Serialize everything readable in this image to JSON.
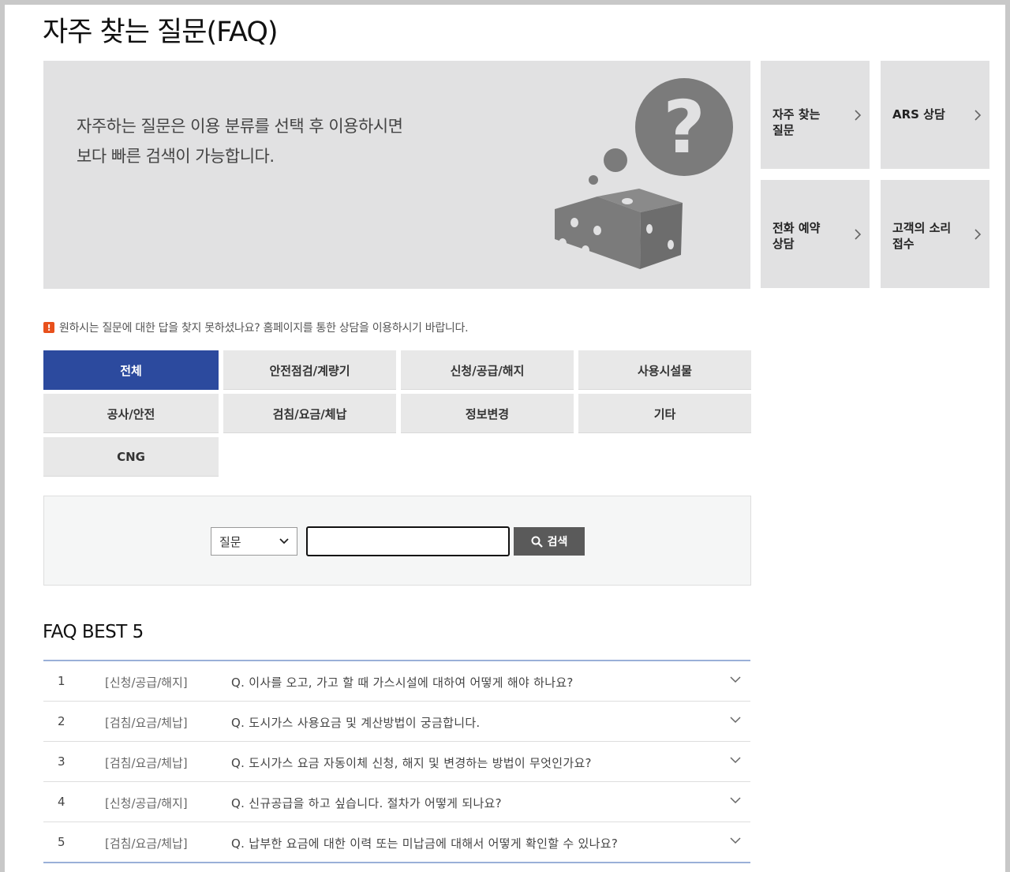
{
  "page": {
    "title": "자주 찾는 질문(FAQ)"
  },
  "hero": {
    "line1": "자주하는 질문은 이용 분류를 선택 후 이용하시면",
    "line2": "보다 빠른 검색이 가능합니다.",
    "illustration": "dice-question-icon"
  },
  "quick_links": [
    {
      "label": "자주 찾는\n질문",
      "icon": "chevron-right-icon"
    },
    {
      "label": "ARS 상담",
      "icon": "chevron-right-icon"
    },
    {
      "label": "전화 예약\n상담",
      "icon": "chevron-right-icon"
    },
    {
      "label": "고객의 소리\n접수",
      "icon": "chevron-right-icon"
    }
  ],
  "notice": {
    "icon": "alert-icon",
    "text": "원하시는 질문에 대한 답을 찾지 못하셨나요? 홈페이지를 통한 상담을 이용하시기 바랍니다."
  },
  "categories": [
    {
      "label": "전체",
      "active": true
    },
    {
      "label": "안전점검/계량기",
      "active": false
    },
    {
      "label": "신청/공급/해지",
      "active": false
    },
    {
      "label": "사용시설물",
      "active": false
    },
    {
      "label": "공사/안전",
      "active": false
    },
    {
      "label": "검침/요금/체납",
      "active": false
    },
    {
      "label": "정보변경",
      "active": false
    },
    {
      "label": "기타",
      "active": false
    },
    {
      "label": "CNG",
      "active": false
    }
  ],
  "search": {
    "select_value": "질문",
    "input_value": "",
    "button_label": "검색"
  },
  "best": {
    "title": "FAQ BEST 5",
    "items": [
      {
        "num": "1",
        "category": "[신청/공급/해지]",
        "question": "Q. 이사를 오고, 가고 할 때 가스시설에 대하여 어떻게 해야 하나요?"
      },
      {
        "num": "2",
        "category": "[검침/요금/체납]",
        "question": "Q. 도시가스 사용요금 및 계산방법이 궁금합니다."
      },
      {
        "num": "3",
        "category": "[검침/요금/체납]",
        "question": "Q. 도시가스 요금 자동이체 신청, 해지 및 변경하는 방법이 무엇인가요?"
      },
      {
        "num": "4",
        "category": "[신청/공급/해지]",
        "question": "Q. 신규공급을 하고 싶습니다. 절차가 어떻게 되나요?"
      },
      {
        "num": "5",
        "category": "[검침/요금/체납]",
        "question": "Q. 납부한 요금에 대한 이력 또는 미납금에 대해서 어떻게 확인할 수 있나요?"
      }
    ]
  },
  "colors": {
    "accent": "#2c4a9e",
    "panel": "#e1e1e2",
    "button": "#e8e8e8",
    "search_button": "#5a5a5a",
    "list_border": "#9ab0d8",
    "alert": "#e8501c"
  }
}
